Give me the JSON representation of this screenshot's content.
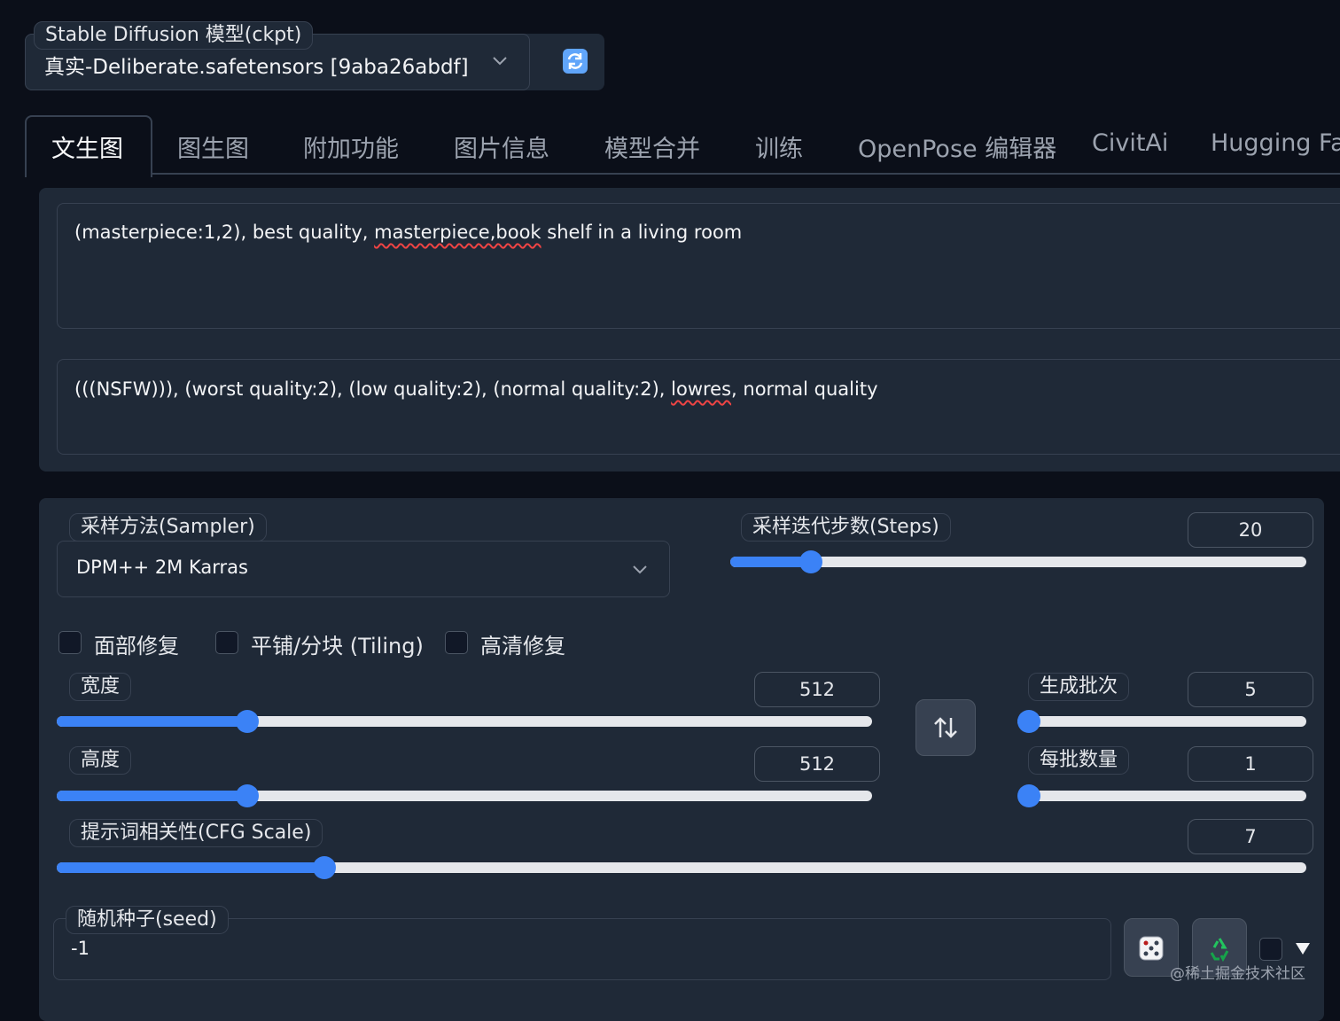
{
  "model": {
    "label": "Stable Diffusion 模型(ckpt)",
    "value": "真实-Deliberate.safetensors [9aba26abdf]"
  },
  "tabs": [
    {
      "label": "文生图",
      "active": true
    },
    {
      "label": "图生图"
    },
    {
      "label": "附加功能"
    },
    {
      "label": "图片信息"
    },
    {
      "label": "模型合并"
    },
    {
      "label": "训练"
    },
    {
      "label": "OpenPose 编辑器"
    },
    {
      "label": "CivitAi"
    },
    {
      "label": "Hugging Face"
    }
  ],
  "prompt": {
    "p1": "(masterpiece:1,2), best quality, ",
    "p_mis1": "masterpiece,book",
    "p2": " shelf in a living room"
  },
  "negative_prompt": {
    "p1": "(((NSFW))), (worst quality:2), (low quality:2), (normal quality:2), ",
    "p_mis1": "lowres",
    "p2": ", normal quality"
  },
  "sampler": {
    "label": "采样方法(Sampler)",
    "value": "DPM++ 2M Karras"
  },
  "steps": {
    "label": "采样迭代步数(Steps)",
    "value": "20",
    "fraction": 0.14
  },
  "checkboxes": {
    "face_restore": "面部修复",
    "tiling": "平铺/分块 (Tiling)",
    "hires_fix": "高清修复"
  },
  "width": {
    "label": "宽度",
    "value": "512",
    "fraction": 0.234
  },
  "height": {
    "label": "高度",
    "value": "512",
    "fraction": 0.234
  },
  "batch_count": {
    "label": "生成批次",
    "value": "5",
    "fraction": 0.04
  },
  "batch_size": {
    "label": "每批数量",
    "value": "1",
    "fraction": 0.0
  },
  "cfg": {
    "label": "提示词相关性(CFG Scale)",
    "value": "7",
    "fraction": 0.214
  },
  "seed": {
    "label": "随机种子(seed)",
    "value": "-1"
  },
  "icons": {
    "refresh": "refresh-icon",
    "swap": "swap-arrows-icon",
    "dice": "dice-icon",
    "recycle": "recycle-icon",
    "expand": "triangle-down-icon"
  },
  "watermark": "@稀土掘金技术社区",
  "colors": {
    "accent": "#3b82f6",
    "background": "#0b0f19",
    "panel": "#1f2937"
  }
}
